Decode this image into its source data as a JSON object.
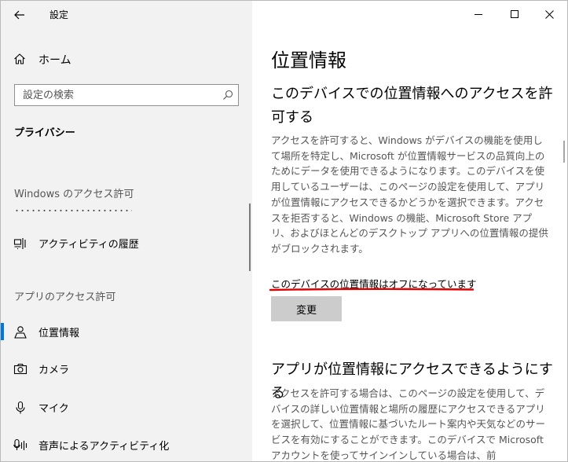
{
  "window": {
    "title": "設定"
  },
  "nav": {
    "home_label": "ホーム",
    "search_placeholder": "設定の検索",
    "category": "プライバシー",
    "section_windows": "Windows のアクセス許可",
    "activity_label": "アクティビティの履歴",
    "section_apps": "アプリのアクセス許可",
    "location_label": "位置情報",
    "camera_label": "カメラ",
    "mic_label": "マイク",
    "voice_label": "音声によるアクティビティ化"
  },
  "main": {
    "page_title": "位置情報",
    "device_heading": "このデバイスでの位置情報へのアクセスを許可する",
    "device_desc": "アクセスを許可すると、Windows がデバイスの機能を使用して場所を特定し、Microsoft が位置情報サービスの品質向上のためにデータを使用できるようになります。このデバイスを使用しているユーザーは、このページの設定を使用して、アプリが位置情報にアクセスできるかどうかを選択できます。アクセスを拒否すると、Windows の機能、Microsoft Store アプリ、およびほとんどのデスクトップ アプリへの位置情報の提供がブロックされます。",
    "device_status": "このデバイスの位置情報はオフになっています",
    "change_button": "変更",
    "apps_heading": "アプリが位置情報にアクセスできるようにする",
    "apps_desc": "アクセスを許可する場合は、このページの設定を使用して、デバイスの詳しい位置情報と場所の履歴にアクセスできるアプリを選択して、位置情報に基づいたルート案内や天気などのサービスを有効にすることができます。このデバイスで Microsoft アカウントを使ってサインインしている場合は、前"
  },
  "colors": {
    "accent": "#0078d7",
    "annotation": "#e00000",
    "nav_bg": "#f2f2f2"
  }
}
